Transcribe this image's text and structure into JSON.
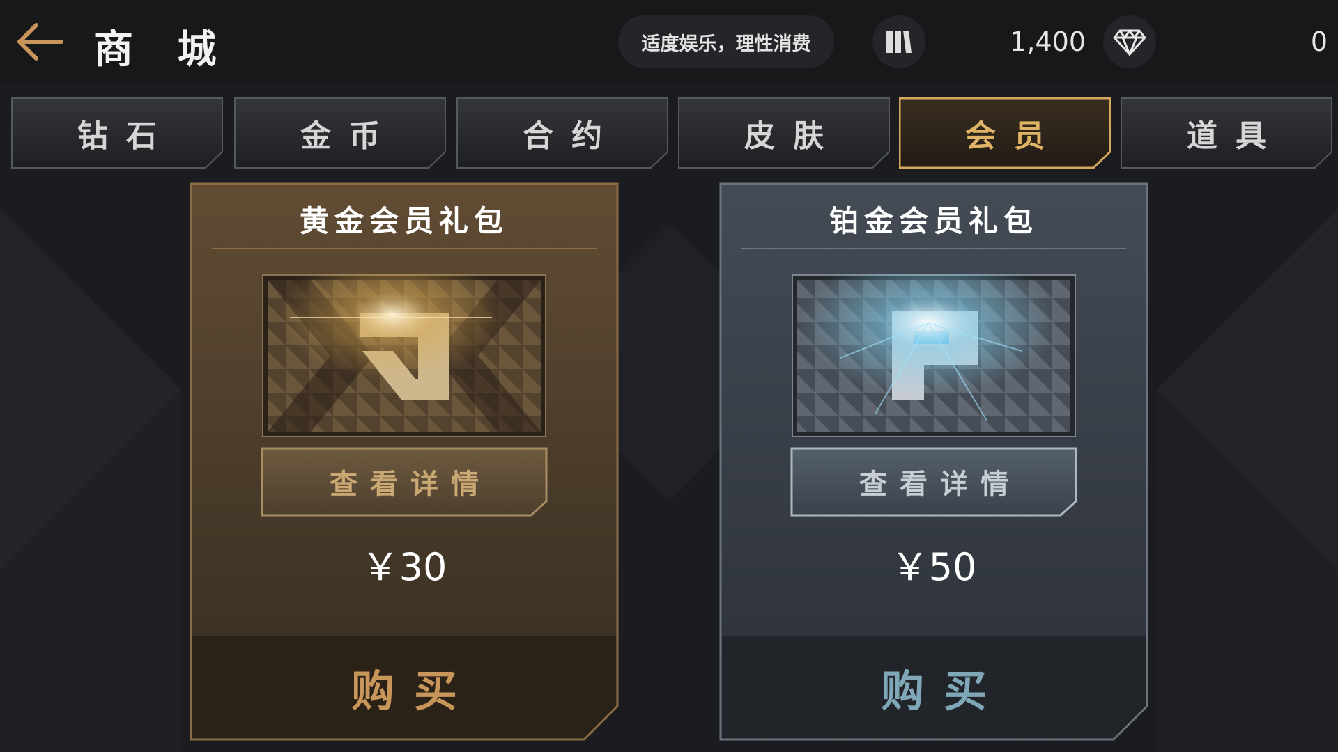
{
  "header": {
    "title": "商 城",
    "notice": "适度娱乐，理性消费",
    "coin_amount": "1,400",
    "diamond_amount": "0",
    "icons": {
      "back": "arrow-left-icon",
      "coin": "coin-stack-icon",
      "diamond": "diamond-icon"
    }
  },
  "tabs": [
    {
      "label": "钻石",
      "active": false
    },
    {
      "label": "金币",
      "active": false
    },
    {
      "label": "合约",
      "active": false
    },
    {
      "label": "皮肤",
      "active": false
    },
    {
      "label": "会员",
      "active": true
    },
    {
      "label": "道具",
      "active": false
    }
  ],
  "packages": [
    {
      "name": "黄金会员礼包",
      "emblem_letter": "G",
      "detail_label": "查看详情",
      "price": "￥30",
      "buy_label": "购买",
      "theme": "gold"
    },
    {
      "name": "铂金会员礼包",
      "emblem_letter": "P",
      "detail_label": "查看详情",
      "price": "￥50",
      "buy_label": "购买",
      "theme": "platinum"
    }
  ],
  "colors": {
    "accent_gold": "#e0b466",
    "gold_card": "#5e4a33",
    "platinum_card": "#3f4650",
    "buy_gold_text": "#c8955a",
    "buy_platinum_text": "#7fa7b8"
  }
}
